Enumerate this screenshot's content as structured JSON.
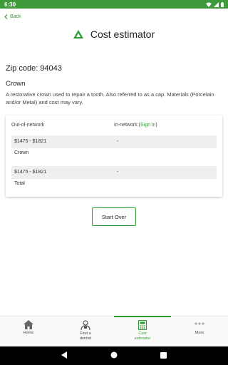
{
  "status_bar": {
    "time": "6:30"
  },
  "header": {
    "back_label": "Back",
    "title": "Cost estimator"
  },
  "content": {
    "zip_label": "Zip code: 94043",
    "procedure_name": "Crown",
    "procedure_description": "A restorative crown used to repair a tooth. Also referred to as a cap. Materials (Porcelain and/or Metal) and cost may vary."
  },
  "table": {
    "col_out": "Out-of-network",
    "col_in": "In-network (",
    "sign_in_link": "Sign in",
    "col_in_close": ")",
    "rows": [
      {
        "out": "$1475 - $1821",
        "in": "-",
        "label": "Crown"
      },
      {
        "out": "$1475 - $1821",
        "in": "-",
        "label": "Total"
      }
    ]
  },
  "start_over_label": "Start Over",
  "bottom_nav": [
    {
      "label_line1": "Home",
      "label_line2": "",
      "icon": "home-icon"
    },
    {
      "label_line1": "Find a",
      "label_line2": "dentist",
      "icon": "dentist-icon"
    },
    {
      "label_line1": "Cost",
      "label_line2": "estimator",
      "icon": "calculator-icon"
    },
    {
      "label_line1": "More",
      "label_line2": "",
      "icon": "more-icon"
    }
  ],
  "colors": {
    "accent": "#2e9b33",
    "status_bar": "#3f9a3c"
  }
}
